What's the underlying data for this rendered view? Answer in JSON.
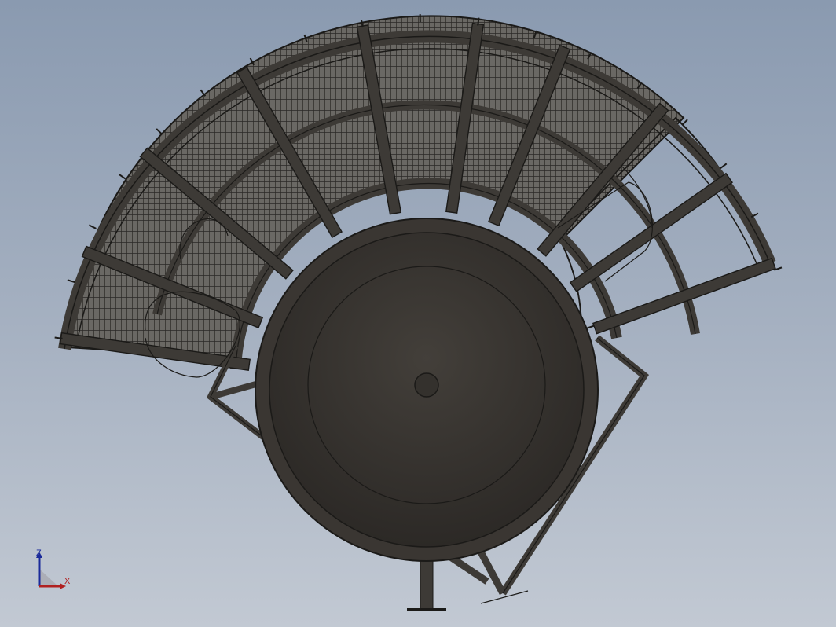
{
  "viewport": {
    "background_top": "#8a9ab0",
    "background_bottom": "#c2c9d3"
  },
  "model": {
    "description_colors": {
      "steel": "#3d3a36",
      "steel_edge": "#1b1a18",
      "grating_fill": "#5e5c58"
    }
  },
  "triad": {
    "z_label": "Z",
    "x_label": "X",
    "z_color": "#1a2a9a",
    "x_color": "#b02020"
  }
}
